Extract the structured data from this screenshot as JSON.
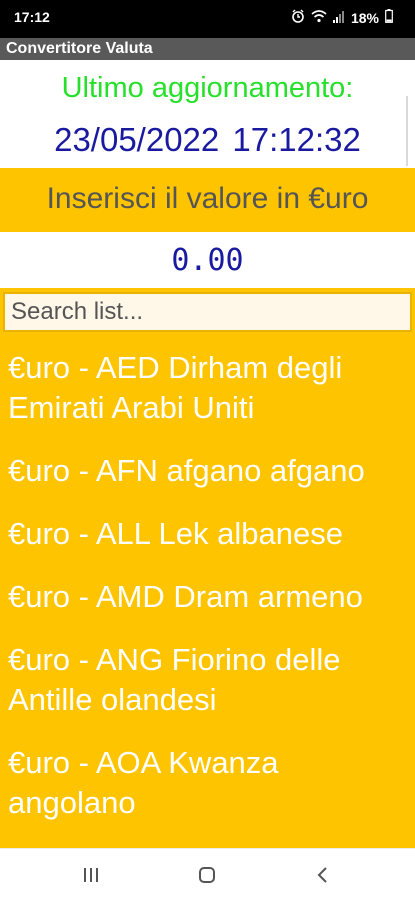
{
  "status_bar": {
    "time": "17:12",
    "battery": "18%",
    "icons": [
      "alarm-icon",
      "wifi-icon",
      "signal-icon",
      "battery-icon"
    ]
  },
  "app": {
    "title": "Convertitore Valuta"
  },
  "last_update": {
    "label": "Ultimo aggiornamento:",
    "value": "23/05/2022 17:12:32"
  },
  "input": {
    "prompt": "Inserisci il valore in €uro",
    "amount": "0.00"
  },
  "search": {
    "placeholder": "Search list..."
  },
  "currencies": [
    {
      "label": "€uro - AED Dirham degli Emirati Arabi Uniti"
    },
    {
      "label": "€uro - AFN afgano afgano"
    },
    {
      "label": "€uro - ALL Lek albanese"
    },
    {
      "label": "€uro - AMD Dram armeno"
    },
    {
      "label": "€uro - ANG Fiorino delle Antille olandesi"
    },
    {
      "label": "€uro - AOA Kwanza angolano"
    }
  ],
  "nav_bar": {
    "buttons": [
      "recents-icon",
      "home-icon",
      "back-icon"
    ]
  },
  "colors": {
    "accent": "#ffc400",
    "update_label": "#27e02b",
    "update_value": "#1a1aa0",
    "app_bar": "#595959"
  }
}
